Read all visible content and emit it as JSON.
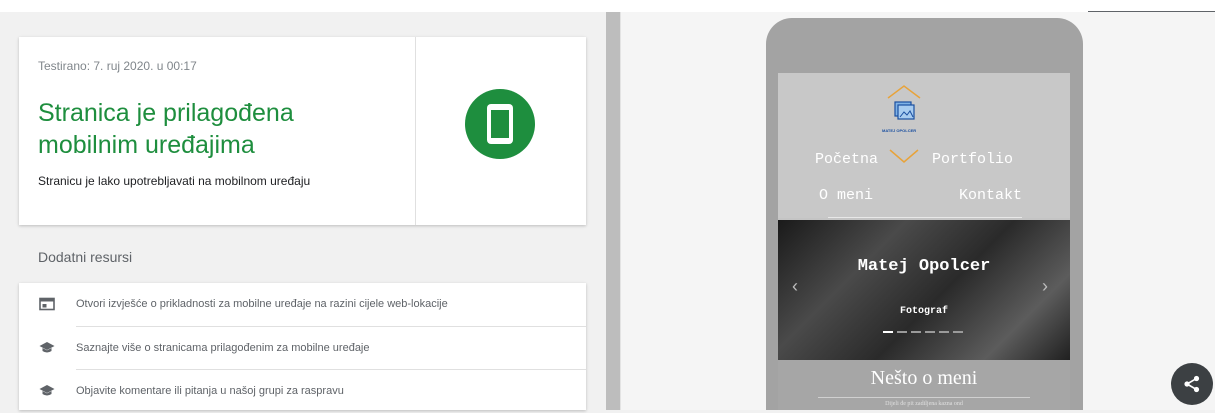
{
  "result": {
    "tested_at": "Testirano: 7. ruj 2020. u 00:17",
    "title": "Stranica je prilagođena mobilnim uređajima",
    "subtitle": "Stranicu je lako upotrebljavati na mobilnom uređaju",
    "status_color": "#1e8e3e",
    "icon": "smartphone-icon"
  },
  "resources": {
    "heading": "Dodatni resursi",
    "items": [
      {
        "icon": "report-icon",
        "label": "Otvori izvješće o prikladnosti za mobilne uređaje na razini cijele web-lokacije"
      },
      {
        "icon": "school-icon",
        "label": "Saznajte više o stranicama prilagođenim za mobilne uređaje"
      },
      {
        "icon": "school-icon",
        "label": "Objavite komentare ili pitanja u našoj grupi za raspravu"
      }
    ]
  },
  "preview": {
    "logo_text": "MATEJ OPOLCER",
    "nav": [
      "Početna",
      "Portfolio",
      "O meni",
      "Kontakt"
    ],
    "hero_name": "Matej Opolcer",
    "hero_role": "Fotograf",
    "carousel_slides": 6,
    "carousel_active": 1,
    "about_title": "Nešto o meni",
    "about_snippet": "Dijeli đe pit zadiljena kazna ond"
  },
  "share": {
    "icon": "share-icon"
  }
}
